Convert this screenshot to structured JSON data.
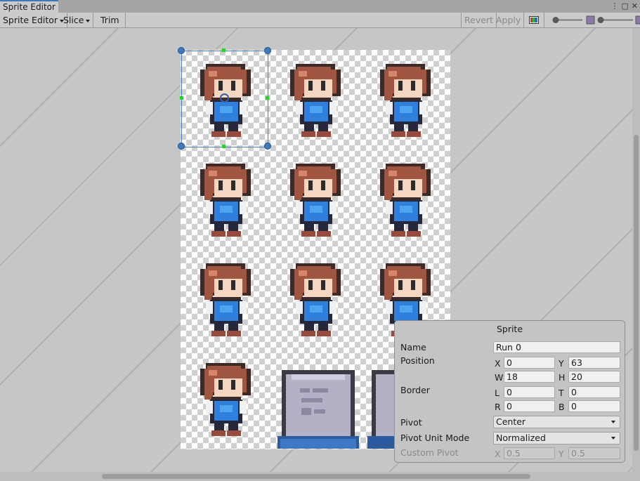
{
  "window": {
    "tab_title": "Sprite Editor",
    "more_icon": "⋮",
    "maximize_icon": "▢",
    "close_icon": "✕"
  },
  "toolbar": {
    "mode_label": "Sprite Editor",
    "slice_label": "Slice",
    "trim_label": "Trim",
    "revert_label": "Revert",
    "apply_label": "Apply"
  },
  "colors": {
    "selection": "#4a7fc1",
    "handle": "#3d79c7",
    "mid_handle": "#21d521"
  },
  "sprite_panel": {
    "title": "Sprite",
    "name_label": "Name",
    "name_value": "Run 0",
    "position_label": "Position",
    "x_label": "X",
    "x_value": "0",
    "y_label": "Y",
    "y_value": "63",
    "w_label": "W",
    "w_value": "18",
    "h_label": "H",
    "h_value": "20",
    "border_label": "Border",
    "l_label": "L",
    "l_value": "0",
    "t_label": "T",
    "t_value": "0",
    "r_label": "R",
    "r_value": "0",
    "b_label": "B",
    "b_value": "0",
    "pivot_label": "Pivot",
    "pivot_value": "Center",
    "pivot_unit_label": "Pivot Unit Mode",
    "pivot_unit_value": "Normalized",
    "custom_pivot_label": "Custom Pivot",
    "cp_x_label": "X",
    "cp_x_value": "0.5",
    "cp_y_label": "Y",
    "cp_y_value": "0.5"
  }
}
